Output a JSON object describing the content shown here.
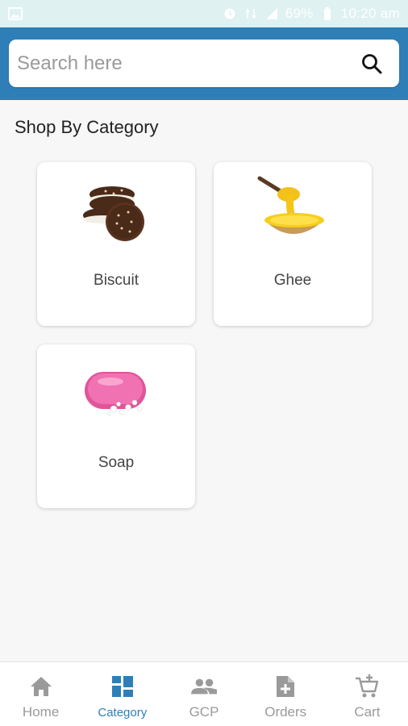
{
  "status_bar": {
    "battery_text": "69%",
    "time": "10:20 am",
    "icons": [
      "image-icon",
      "alarm-icon",
      "network-icon",
      "signal-icon",
      "battery-icon"
    ]
  },
  "search": {
    "placeholder": "Search here",
    "value": ""
  },
  "section": {
    "title": "Shop By Category"
  },
  "categories": [
    {
      "label": "Biscuit",
      "icon": "biscuit-icon"
    },
    {
      "label": "Ghee",
      "icon": "ghee-icon"
    },
    {
      "label": "Soap",
      "icon": "soap-icon"
    }
  ],
  "bottom_nav": {
    "items": [
      {
        "label": "Home",
        "icon": "home-icon",
        "active": false
      },
      {
        "label": "Category",
        "icon": "category-icon",
        "active": true
      },
      {
        "label": "GCP",
        "icon": "people-icon",
        "active": false
      },
      {
        "label": "Orders",
        "icon": "orders-icon",
        "active": false
      },
      {
        "label": "Cart",
        "icon": "cart-icon",
        "active": false
      }
    ]
  },
  "colors": {
    "header": "#2e7fb8",
    "status_bar": "#dff1f1",
    "active_nav": "#2e7fb8",
    "inactive_nav": "#9a9a9a"
  }
}
